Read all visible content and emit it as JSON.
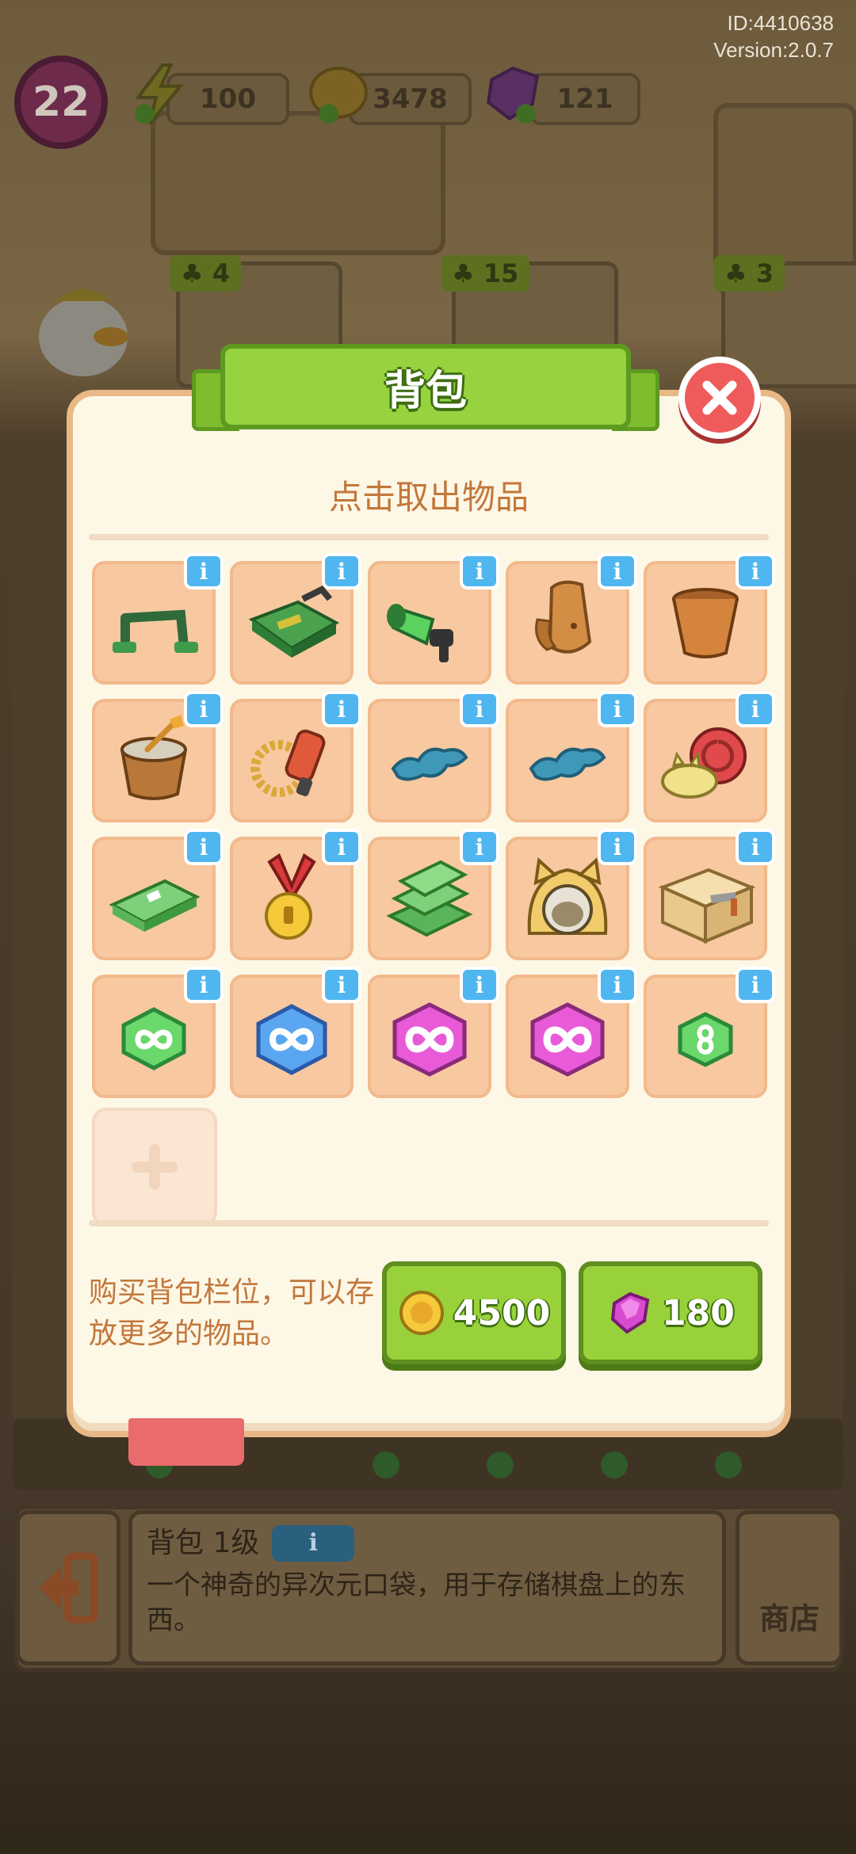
{
  "hud": {
    "id_text": "ID:4410638",
    "version_text": "Version:2.0.7",
    "level": "22",
    "energy": "100",
    "coins": "3478",
    "gems": "121"
  },
  "background": {
    "slot_badges": [
      "4",
      "15",
      "3"
    ]
  },
  "modal": {
    "title": "背包",
    "subtitle": "点击取出物品",
    "info_label": "i",
    "items": [
      {
        "icon": "binoculars-frame-icon"
      },
      {
        "icon": "toolbox-icon"
      },
      {
        "icon": "megaphone-icon"
      },
      {
        "icon": "clay-jar-icon"
      },
      {
        "icon": "flower-pot-icon"
      },
      {
        "icon": "mortar-pot-icon"
      },
      {
        "icon": "drill-chain-icon"
      },
      {
        "icon": "blue-puddle-icon"
      },
      {
        "icon": "blue-puddle-icon"
      },
      {
        "icon": "snail-cat-icon"
      },
      {
        "icon": "cash-stack-icon"
      },
      {
        "icon": "gold-medal-icon"
      },
      {
        "icon": "cash-pile-icon"
      },
      {
        "icon": "cat-bed-icon"
      },
      {
        "icon": "cardboard-box-icon"
      },
      {
        "icon": "green-infinity-gem-icon"
      },
      {
        "icon": "blue-infinity-gem-icon"
      },
      {
        "icon": "pink-infinity-gem-icon"
      },
      {
        "icon": "pink-infinity-gem-icon"
      },
      {
        "icon": "small-green-infinity-gem-icon"
      }
    ],
    "buy_text": "购买背包栏位，可以存放更多的物品。",
    "buy_coin_price": "4500",
    "buy_gem_price": "180"
  },
  "bottom": {
    "title": "背包 1级",
    "info_label": "i",
    "description": "一个神奇的异次元口袋，用于存储棋盘上的东西。",
    "shop_label": "商店"
  },
  "colors": {
    "accent_green": "#96d33f",
    "close_red": "#ef5b5b",
    "info_blue": "#4fb6f0",
    "cell_peach": "#f8c8a0",
    "text_brown": "#c2773b"
  }
}
